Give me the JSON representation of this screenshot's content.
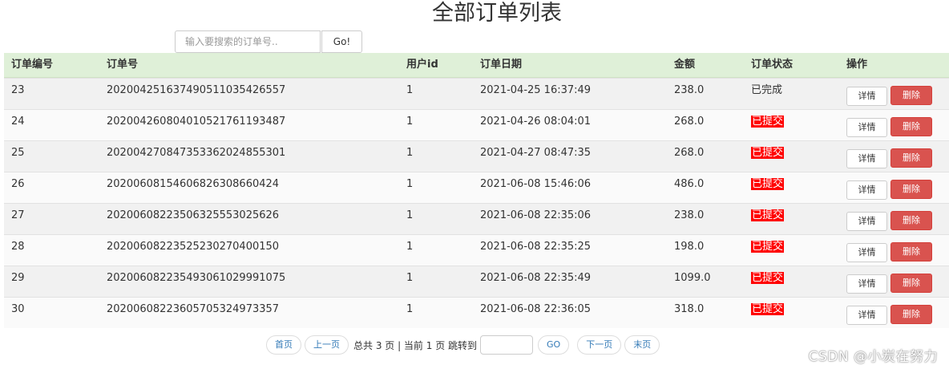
{
  "page": {
    "title": "全部订单列表"
  },
  "search": {
    "placeholder": "输入要搜索的订单号..",
    "button_label": "Go!"
  },
  "table": {
    "headers": [
      "订单编号",
      "订单号",
      "用户id",
      "订单日期",
      "金额",
      "订单状态",
      "操作"
    ],
    "rows": [
      {
        "id": "23",
        "order_no": "20200425163749051103542655​7",
        "user_id": "1",
        "date": "2021-04-25 16:37:49",
        "amount": "238.0",
        "status": "已完成",
        "status_type": "done",
        "detail_label": "详情",
        "delete_label": "删除"
      },
      {
        "id": "24",
        "order_no": "202004260804010521761193487",
        "user_id": "1",
        "date": "2021-04-26 08:04:01",
        "amount": "268.0",
        "status": "已提交",
        "status_type": "submitted",
        "detail_label": "详情",
        "delete_label": "删除"
      },
      {
        "id": "25",
        "order_no": "202004270847353362024855301",
        "user_id": "1",
        "date": "2021-04-27 08:47:35",
        "amount": "268.0",
        "status": "已提交",
        "status_type": "submitted",
        "detail_label": "详情",
        "delete_label": "删除"
      },
      {
        "id": "26",
        "order_no": "202006081546068263086604​24",
        "user_id": "1",
        "date": "2021-06-08 15:46:06",
        "amount": "486.0",
        "status": "已提交",
        "status_type": "submitted",
        "detail_label": "详情",
        "delete_label": "删除"
      },
      {
        "id": "27",
        "order_no": "202006082235063255530256​26",
        "user_id": "1",
        "date": "2021-06-08 22:35:06",
        "amount": "238.0",
        "status": "已提交",
        "status_type": "submitted",
        "detail_label": "详情",
        "delete_label": "删除"
      },
      {
        "id": "28",
        "order_no": "202006082235252302704001​50",
        "user_id": "1",
        "date": "2021-06-08 22:35:25",
        "amount": "198.0",
        "status": "已提交",
        "status_type": "submitted",
        "detail_label": "详情",
        "delete_label": "删除"
      },
      {
        "id": "29",
        "order_no": "202006082235493061029991075",
        "user_id": "1",
        "date": "2021-06-08 22:35:49",
        "amount": "1099.0",
        "status": "已提交",
        "status_type": "submitted",
        "detail_label": "详情",
        "delete_label": "删除"
      },
      {
        "id": "30",
        "order_no": "202006082236057053249733​57",
        "user_id": "1",
        "date": "2021-06-08 22:36:05",
        "amount": "318.0",
        "status": "已提交",
        "status_type": "submitted",
        "detail_label": "详情",
        "delete_label": "删除"
      }
    ]
  },
  "pagination": {
    "first_label": "首页",
    "prev_label": "上一页",
    "summary": "总共 3 页 | 当前 1 页 跳转到",
    "go_label": "GO",
    "next_label": "下一页",
    "last_label": "末页"
  },
  "watermark": "CSDN @小炭在努力",
  "colors": {
    "header_bg": "#dff0d8",
    "delete_button": "#d9534f",
    "submitted_status": "#ff0000",
    "pagination_link": "#337ab7"
  }
}
